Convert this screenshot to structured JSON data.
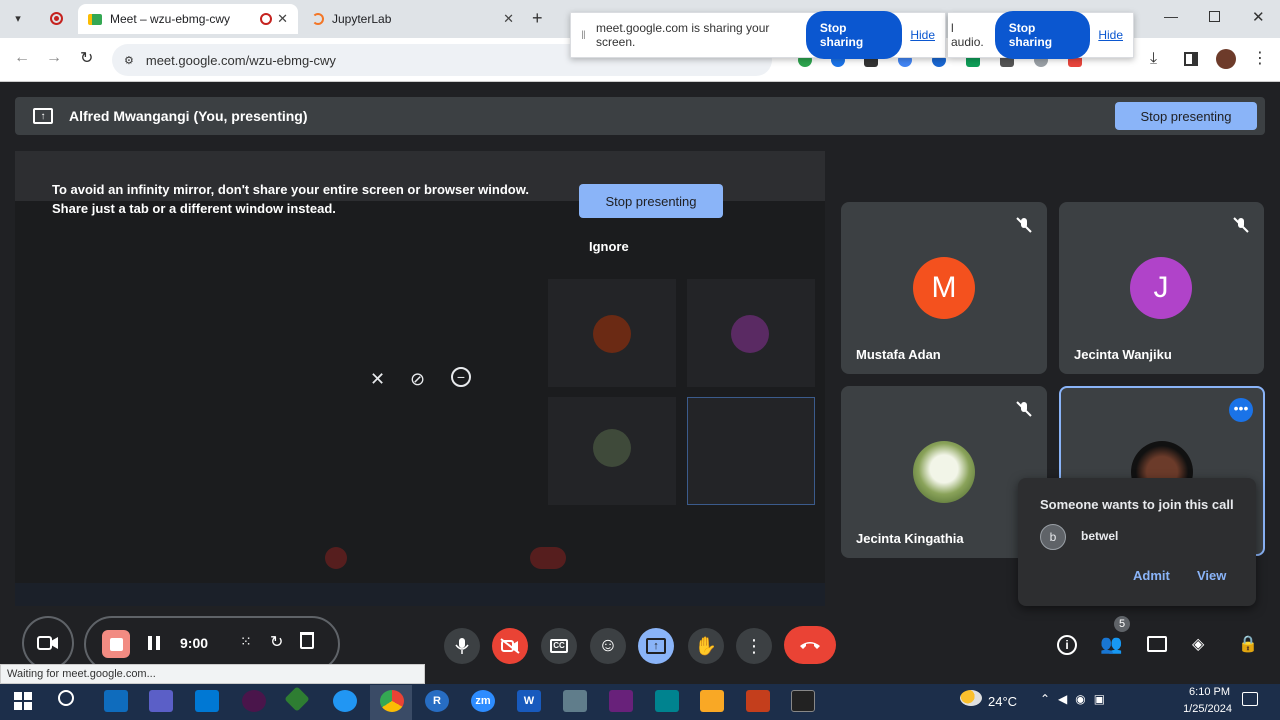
{
  "browser": {
    "tabs": [
      {
        "label": "Meet – wzu-ebmg-cwy"
      },
      {
        "label": "JupyterLab"
      }
    ],
    "url": "meet.google.com/wzu-ebmg-cwy"
  },
  "share_bars": [
    {
      "text": "meet.google.com is sharing your screen.",
      "stop": "Stop sharing",
      "hide": "Hide"
    },
    {
      "text": "l audio.",
      "stop": "Stop sharing",
      "hide": "Hide"
    }
  ],
  "meet": {
    "presenting_label": "Alfred Mwangangi (You, presenting)",
    "stop_presenting_top": "Stop presenting",
    "mirror_warning_line1": "To avoid an infinity mirror, don't share your entire screen or browser window.",
    "mirror_warning_line2": "Share just a tab or a different window instead.",
    "stop_presenting_center": "Stop presenting",
    "ignore": "Ignore",
    "participants": [
      {
        "name": "Mustafa Adan",
        "initial": "M",
        "color": "#f4511e"
      },
      {
        "name": "Jecinta Wanjiku",
        "initial": "J",
        "color": "#b043c9"
      },
      {
        "name": "Jecinta Kingathia",
        "initial": ""
      },
      {
        "name": "",
        "initial": ""
      }
    ],
    "join_popup": {
      "title": "Someone wants to join this call",
      "requester_initial": "b",
      "requester_name": "betwel",
      "admit": "Admit",
      "view": "View"
    },
    "recording": {
      "timer": "9:00"
    },
    "people_count": "5"
  },
  "status_bar": "Waiting for meet.google.com...",
  "taskbar": {
    "weather": "24°C",
    "time": "6:10 PM",
    "date": "1/25/2024",
    "apps": [
      "R",
      "zm",
      "W"
    ]
  },
  "colors": {
    "accent": "#8ab4f8",
    "danger": "#ea4335",
    "brand_blue": "#0b57d0"
  }
}
